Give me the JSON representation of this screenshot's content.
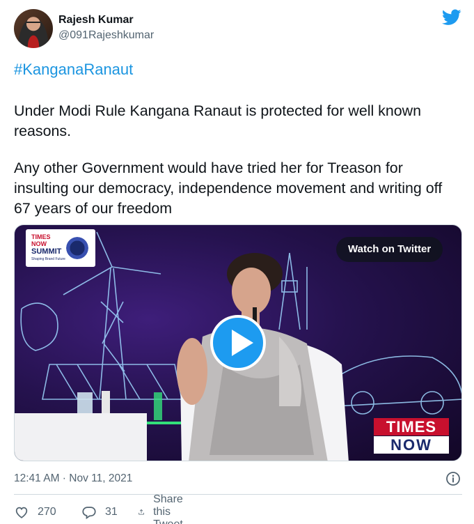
{
  "author": {
    "name": "Rajesh Kumar",
    "handle": "@091Rajeshkumar"
  },
  "hashtag": "#KanganaRanaut",
  "body": {
    "paragraph1": "Under Modi Rule Kangana Ranaut is protected for well known reasons.",
    "paragraph2": "Any other Government would have tried her for Treason for insulting our democracy, independence movement and writing off 67 years of our freedom"
  },
  "media": {
    "watch_label": "Watch on Twitter",
    "event_badge": {
      "line1": "TIMES",
      "line2": "NOW",
      "line3": "SUMMIT",
      "line4": "Shaping Brand Future"
    },
    "channel_logo": {
      "top": "TIMES",
      "bottom": "NOW"
    }
  },
  "timestamp": "12:41 AM · Nov 11, 2021",
  "actions": {
    "likes": "270",
    "replies": "31",
    "share_label": "Share this Tweet"
  },
  "colors": {
    "accent": "#1d9bf0",
    "hashtag": "#1b95e0",
    "secondary_text": "#536471"
  },
  "icons": [
    "twitter-bird-icon",
    "play-icon",
    "info-icon",
    "heart-icon",
    "reply-icon",
    "share-icon"
  ]
}
